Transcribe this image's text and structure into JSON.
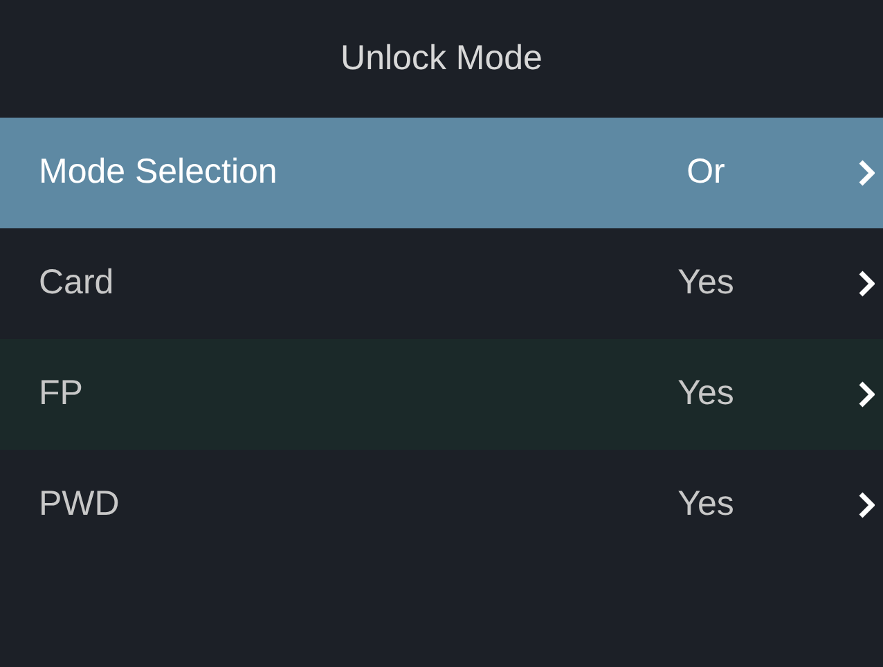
{
  "header": {
    "title": "Unlock Mode"
  },
  "rows": [
    {
      "label": "Mode Selection",
      "value": "Or",
      "selected": true
    },
    {
      "label": "Card",
      "value": "Yes",
      "selected": false
    },
    {
      "label": "FP",
      "value": "Yes",
      "selected": false
    },
    {
      "label": "PWD",
      "value": "Yes",
      "selected": false
    }
  ]
}
